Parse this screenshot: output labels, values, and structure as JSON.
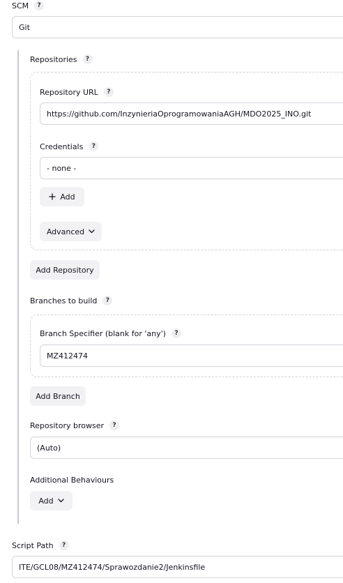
{
  "scm": {
    "label": "SCM",
    "help": "?",
    "value": "Git"
  },
  "repositories": {
    "label": "Repositories",
    "help": "?",
    "url": {
      "label": "Repository URL",
      "help": "?",
      "value": "https://github.com/InzynieriaOprogramowaniaAGH/MDO2025_INO.git"
    },
    "credentials": {
      "label": "Credentials",
      "help": "?",
      "value": "- none -",
      "add_label": "Add"
    },
    "advanced_label": "Advanced",
    "add_repository_label": "Add Repository"
  },
  "branches": {
    "label": "Branches to build",
    "help": "?",
    "specifier": {
      "label": "Branch Specifier (blank for 'any')",
      "help": "?",
      "value": "MZ412474"
    },
    "add_branch_label": "Add Branch"
  },
  "repository_browser": {
    "label": "Repository browser",
    "help": "?",
    "value": "(Auto)"
  },
  "additional_behaviours": {
    "label": "Additional Behaviours",
    "add_label": "Add"
  },
  "script_path": {
    "label": "Script Path",
    "help": "?",
    "value": "ITE/GCL08/MZ412474/Sprawozdanie2/Jenkinsfile"
  }
}
